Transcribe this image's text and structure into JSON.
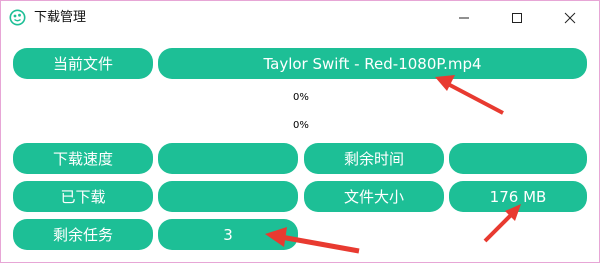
{
  "window": {
    "title": "下载管理"
  },
  "colors": {
    "accent": "#1dbf96",
    "annotation_arrow": "#e83a30"
  },
  "icons": {
    "app": "download-manager-icon",
    "minimize": "minimize-icon",
    "maximize": "maximize-icon",
    "close": "close-icon"
  },
  "fields": {
    "current_file_label": "当前文件",
    "current_file_value": "Taylor Swift - Red-1080P.mp4",
    "progress_1_text": "0%",
    "progress_2_text": "0%",
    "speed_label": "下载速度",
    "speed_value": "",
    "remaining_time_label": "剩余时间",
    "remaining_time_value": "",
    "downloaded_label": "已下载",
    "downloaded_value": "",
    "file_size_label": "文件大小",
    "file_size_value": "176 MB",
    "remaining_tasks_label": "剩余任务",
    "remaining_tasks_value": "3"
  },
  "progress": {
    "bar_1": 0,
    "bar_2": 0
  }
}
